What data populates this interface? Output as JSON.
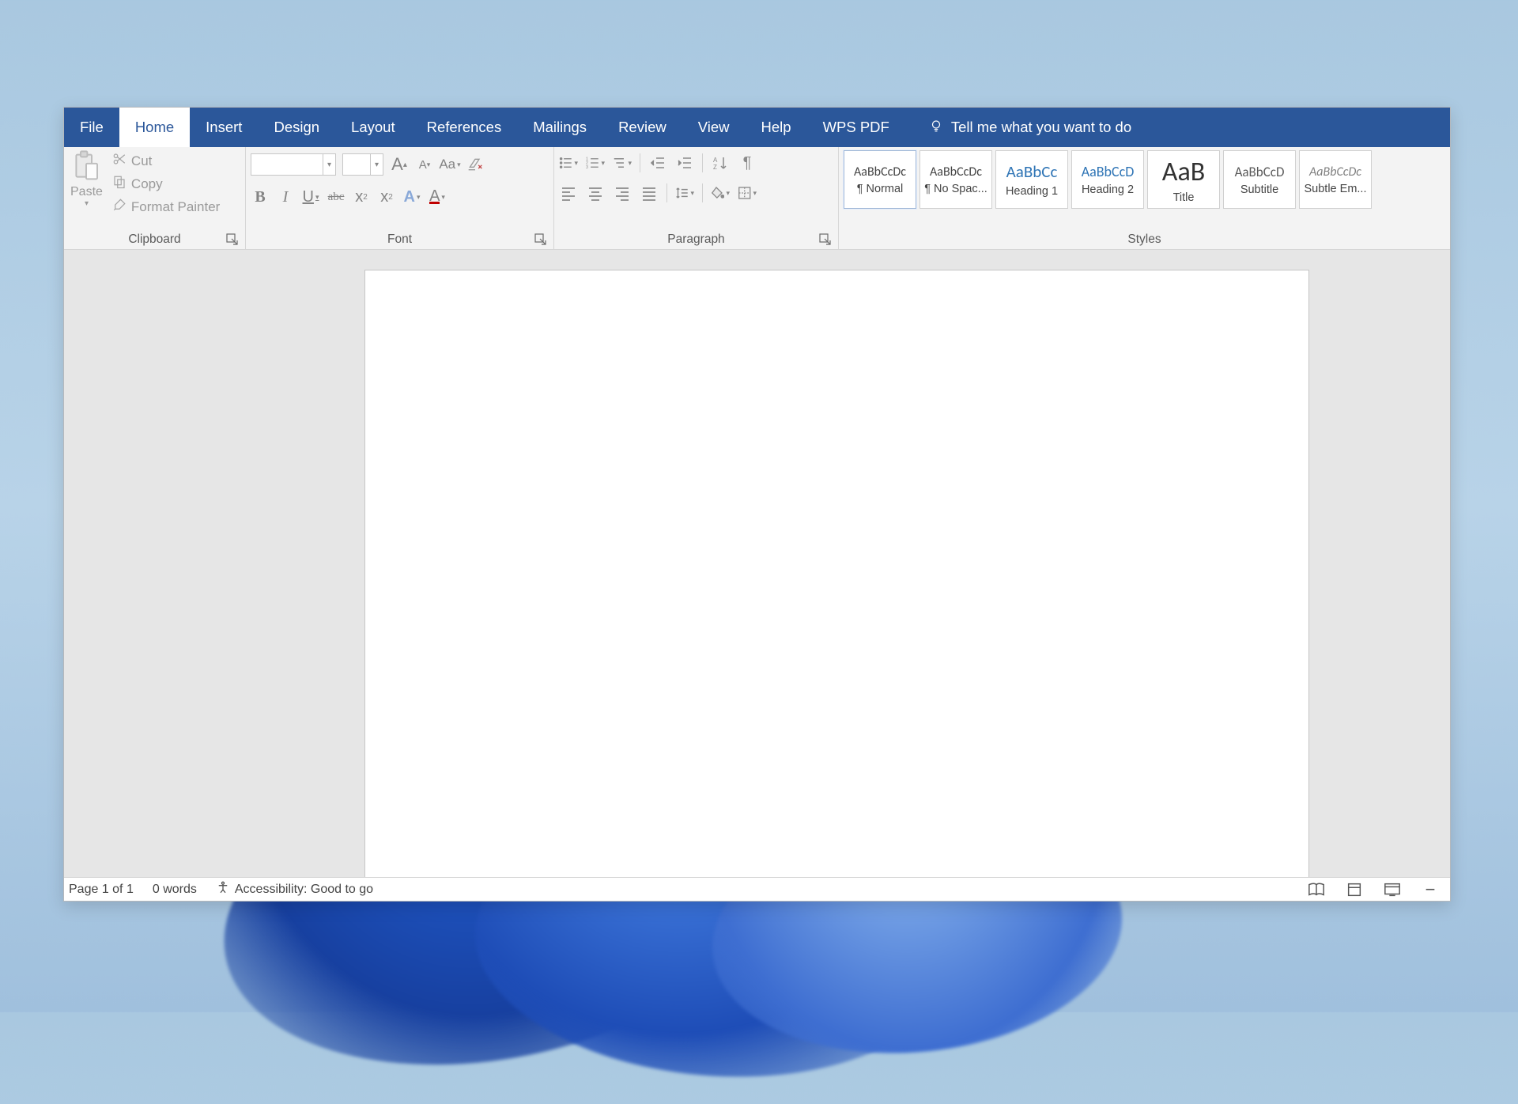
{
  "tabs": {
    "file": "File",
    "home": "Home",
    "insert": "Insert",
    "design": "Design",
    "layout": "Layout",
    "references": "References",
    "mailings": "Mailings",
    "review": "Review",
    "view": "View",
    "help": "Help",
    "wpspdf": "WPS PDF",
    "tellme": "Tell me what you want to do",
    "active": "home"
  },
  "ribbon": {
    "clipboard": {
      "label": "Clipboard",
      "paste": "Paste",
      "cut": "Cut",
      "copy": "Copy",
      "formatpainter": "Format Painter"
    },
    "font": {
      "label": "Font",
      "fontname": "",
      "fontsize": "",
      "growA": "A",
      "shrinkA": "A",
      "caseAa": "Aa",
      "bold": "B",
      "italic": "I",
      "underline": "U",
      "strike": "abc",
      "sub": "x",
      "sub2": "2",
      "sup": "x",
      "sup2": "2",
      "hiliteA": "A",
      "colorA": "A"
    },
    "paragraph": {
      "label": "Paragraph"
    },
    "styles": {
      "label": "Styles",
      "items": [
        {
          "preview": "AaBbCcDc",
          "name": "¶ Normal",
          "size": 16,
          "color": "#444",
          "style": "normal",
          "weight": "400",
          "selected": true
        },
        {
          "preview": "AaBbCcDc",
          "name": "¶ No Spac...",
          "size": 16,
          "color": "#444",
          "style": "normal",
          "weight": "400"
        },
        {
          "preview": "AaBbCc",
          "name": "Heading 1",
          "size": 21,
          "color": "#2e74b5",
          "style": "normal",
          "weight": "400"
        },
        {
          "preview": "AaBbCcD",
          "name": "Heading 2",
          "size": 18,
          "color": "#2e74b5",
          "style": "normal",
          "weight": "400"
        },
        {
          "preview": "AaB",
          "name": "Title",
          "size": 34,
          "color": "#333",
          "style": "normal",
          "weight": "300"
        },
        {
          "preview": "AaBbCcD",
          "name": "Subtitle",
          "size": 17,
          "color": "#5a5a5a",
          "style": "normal",
          "weight": "400"
        },
        {
          "preview": "AaBbCcDc",
          "name": "Subtle Em...",
          "size": 16,
          "color": "#808080",
          "style": "italic",
          "weight": "400"
        }
      ]
    }
  },
  "status": {
    "page": "Page 1 of 1",
    "words": "0 words",
    "accessibility": "Accessibility: Good to go"
  }
}
